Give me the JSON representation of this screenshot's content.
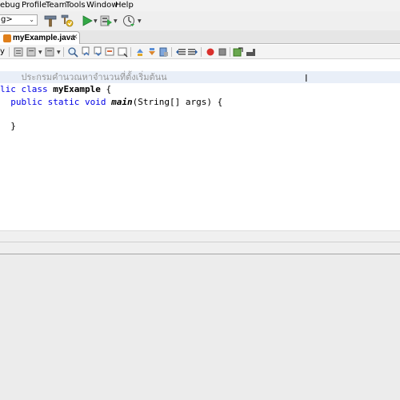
{
  "menubar": {
    "items": [
      "ebug",
      "Profile",
      "Team",
      "Tools",
      "Window",
      "Help"
    ]
  },
  "toolbar": {
    "config_value": "g>",
    "config_arrow": "⌄",
    "icons": [
      "clean-build-hammer-icon",
      "build-icon",
      "run-icon",
      "debug-icon",
      "profile-icon"
    ]
  },
  "tabs": {
    "file_tab_label": "myExample.java",
    "close_glyph": "✕"
  },
  "editor_toolbar": {
    "history_label": "y"
  },
  "editor": {
    "comment": "ประกรมคำนวณหาจำนวนที่ตั้งเริ่มต้นน",
    "line_class_kw1": "lic",
    "line_class_kw2": "class",
    "line_class_name": "myExample",
    "line_class_brace": "{",
    "line_main_kw1": "public",
    "line_main_kw2": "static",
    "line_main_kw3": "void",
    "line_main_method": "main",
    "line_main_params": "(String[] args) {",
    "line_close_brace": "}",
    "cursor_glyph": "I"
  },
  "colors": {
    "keyword": "#0000e6",
    "comment": "#969696",
    "current_line": "#e9eff8"
  }
}
